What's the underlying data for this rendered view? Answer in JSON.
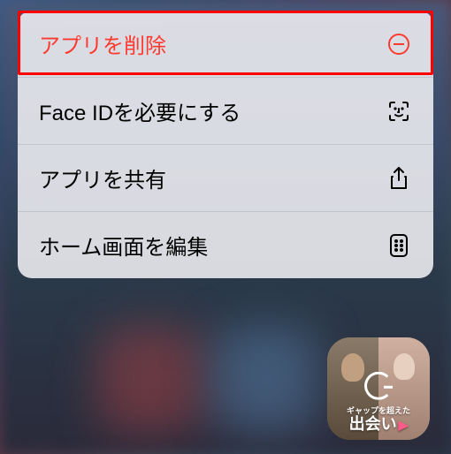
{
  "menu": {
    "items": [
      {
        "label": "アプリを削除",
        "danger": true
      },
      {
        "label": "Face IDを必要にする",
        "danger": false
      },
      {
        "label": "アプリを共有",
        "danger": false
      },
      {
        "label": "ホーム画面を編集",
        "danger": false
      }
    ]
  },
  "app_icon": {
    "tagline": "ギャップを超えた",
    "main_text": "出会い"
  }
}
